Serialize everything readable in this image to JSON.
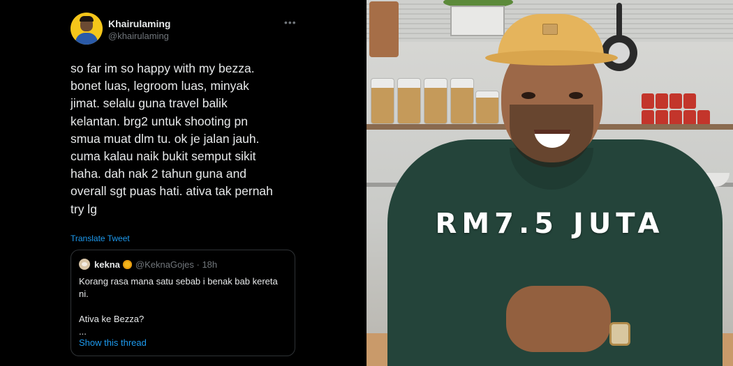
{
  "tweet": {
    "author_name": "Khairulaming",
    "author_handle": "@khairulaming",
    "more_icon": "more-horizontal-icon",
    "body_lines": [
      "so far im so happy with my bezza.",
      "bonet luas, legroom luas, minyak",
      "jimat. selalu guna travel balik",
      "kelantan. brg2 untuk shooting pn",
      "smua muat dlm tu. ok je jalan jauh.",
      "cuma kalau naik bukit semput sikit",
      "haha. dah nak 2 tahun guna and",
      "overall sgt puas hati. ativa tak pernah",
      "try lg"
    ],
    "translate_label": "Translate Tweet",
    "quoted": {
      "name": "kekna",
      "emoji_icon": "sunflower-icon",
      "handle_time": "@KeknaGojes · 18h",
      "text_lines": [
        "Korang rasa mana satu sebab i benak bab kereta",
        "ni.",
        "",
        "Ativa ke Bezza?",
        "..."
      ],
      "show_thread_label": "Show this thread"
    }
  },
  "video": {
    "caption": "RM7.5 JUTA"
  },
  "colors": {
    "background": "#000000",
    "text_primary": "#e7e9ea",
    "text_secondary": "#71767b",
    "link": "#1d9bf0",
    "card_border": "#2f3336"
  }
}
